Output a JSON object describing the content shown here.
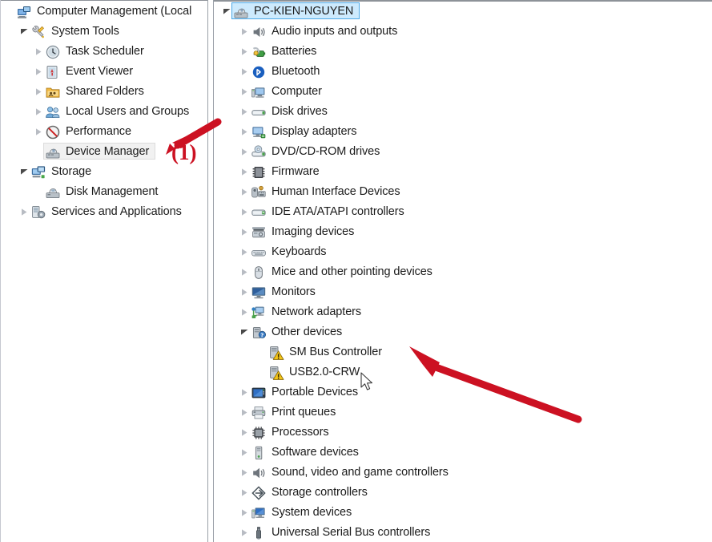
{
  "window": {
    "title": "Computer Management",
    "left_panel_name": "Console Tree",
    "right_panel_name": "Device Manager Tree"
  },
  "left_tree": [
    {
      "label": "Computer Management (Local",
      "depth": 0,
      "twisty": "none",
      "icon": "computer-management-icon",
      "selected": "none"
    },
    {
      "label": "System Tools",
      "depth": 1,
      "twisty": "expanded",
      "icon": "system-tools-icon",
      "selected": "none"
    },
    {
      "label": "Task Scheduler",
      "depth": 2,
      "twisty": "collapsed",
      "icon": "clock-icon",
      "selected": "none"
    },
    {
      "label": "Event Viewer",
      "depth": 2,
      "twisty": "collapsed",
      "icon": "event-viewer-icon",
      "selected": "none"
    },
    {
      "label": "Shared Folders",
      "depth": 2,
      "twisty": "collapsed",
      "icon": "shared-folders-icon",
      "selected": "none"
    },
    {
      "label": "Local Users and Groups",
      "depth": 2,
      "twisty": "collapsed",
      "icon": "users-group-icon",
      "selected": "none"
    },
    {
      "label": "Performance",
      "depth": 2,
      "twisty": "collapsed",
      "icon": "performance-icon",
      "selected": "none"
    },
    {
      "label": "Device Manager",
      "depth": 2,
      "twisty": "none",
      "icon": "device-manager-icon",
      "selected": "gray"
    },
    {
      "label": "Storage",
      "depth": 1,
      "twisty": "expanded",
      "icon": "storage-icon",
      "selected": "none"
    },
    {
      "label": "Disk Management",
      "depth": 2,
      "twisty": "none",
      "icon": "disk-management-icon",
      "selected": "none"
    },
    {
      "label": "Services and Applications",
      "depth": 1,
      "twisty": "collapsed",
      "icon": "services-icon",
      "selected": "none"
    }
  ],
  "right_tree": [
    {
      "label": "PC-KIEN-NGUYEN",
      "depth": 0,
      "twisty": "expanded",
      "icon": "computer-root-icon",
      "selected": "blue"
    },
    {
      "label": "Audio inputs and outputs",
      "depth": 1,
      "twisty": "collapsed",
      "icon": "audio-icon",
      "selected": "none"
    },
    {
      "label": "Batteries",
      "depth": 1,
      "twisty": "collapsed",
      "icon": "battery-icon",
      "selected": "none"
    },
    {
      "label": "Bluetooth",
      "depth": 1,
      "twisty": "collapsed",
      "icon": "bluetooth-icon",
      "selected": "none"
    },
    {
      "label": "Computer",
      "depth": 1,
      "twisty": "collapsed",
      "icon": "computer-icon",
      "selected": "none"
    },
    {
      "label": "Disk drives",
      "depth": 1,
      "twisty": "collapsed",
      "icon": "disk-drive-icon",
      "selected": "none"
    },
    {
      "label": "Display adapters",
      "depth": 1,
      "twisty": "collapsed",
      "icon": "display-adapter-icon",
      "selected": "none"
    },
    {
      "label": "DVD/CD-ROM drives",
      "depth": 1,
      "twisty": "collapsed",
      "icon": "dvd-drive-icon",
      "selected": "none"
    },
    {
      "label": "Firmware",
      "depth": 1,
      "twisty": "collapsed",
      "icon": "firmware-icon",
      "selected": "none"
    },
    {
      "label": "Human Interface Devices",
      "depth": 1,
      "twisty": "collapsed",
      "icon": "hid-icon",
      "selected": "none"
    },
    {
      "label": "IDE ATA/ATAPI controllers",
      "depth": 1,
      "twisty": "collapsed",
      "icon": "ide-controller-icon",
      "selected": "none"
    },
    {
      "label": "Imaging devices",
      "depth": 1,
      "twisty": "collapsed",
      "icon": "imaging-icon",
      "selected": "none"
    },
    {
      "label": "Keyboards",
      "depth": 1,
      "twisty": "collapsed",
      "icon": "keyboard-icon",
      "selected": "none"
    },
    {
      "label": "Mice and other pointing devices",
      "depth": 1,
      "twisty": "collapsed",
      "icon": "mouse-icon",
      "selected": "none"
    },
    {
      "label": "Monitors",
      "depth": 1,
      "twisty": "collapsed",
      "icon": "monitor-icon",
      "selected": "none"
    },
    {
      "label": "Network adapters",
      "depth": 1,
      "twisty": "collapsed",
      "icon": "network-adapter-icon",
      "selected": "none"
    },
    {
      "label": "Other devices",
      "depth": 1,
      "twisty": "expanded",
      "icon": "other-devices-icon",
      "selected": "none"
    },
    {
      "label": "SM Bus Controller",
      "depth": 2,
      "twisty": "none",
      "icon": "warning-device-icon",
      "selected": "none"
    },
    {
      "label": "USB2.0-CRW",
      "depth": 2,
      "twisty": "none",
      "icon": "warning-device-icon",
      "selected": "none"
    },
    {
      "label": "Portable Devices",
      "depth": 1,
      "twisty": "collapsed",
      "icon": "portable-device-icon",
      "selected": "none"
    },
    {
      "label": "Print queues",
      "depth": 1,
      "twisty": "collapsed",
      "icon": "printer-icon",
      "selected": "none"
    },
    {
      "label": "Processors",
      "depth": 1,
      "twisty": "collapsed",
      "icon": "processor-icon",
      "selected": "none"
    },
    {
      "label": "Software devices",
      "depth": 1,
      "twisty": "collapsed",
      "icon": "software-device-icon",
      "selected": "none"
    },
    {
      "label": "Sound, video and game controllers",
      "depth": 1,
      "twisty": "collapsed",
      "icon": "sound-icon",
      "selected": "none"
    },
    {
      "label": "Storage controllers",
      "depth": 1,
      "twisty": "collapsed",
      "icon": "storage-controller-icon",
      "selected": "none"
    },
    {
      "label": "System devices",
      "depth": 1,
      "twisty": "collapsed",
      "icon": "system-device-icon",
      "selected": "none"
    },
    {
      "label": "Universal Serial Bus controllers",
      "depth": 1,
      "twisty": "collapsed",
      "icon": "usb-icon",
      "selected": "none"
    }
  ],
  "annotations": {
    "step_one_label": "(1)",
    "arrow_color": "#cc1122",
    "arrow_one_name": "arrow-pointing-to-device-manager",
    "arrow_two_name": "arrow-pointing-to-sm-bus-controller"
  },
  "colors": {
    "selection_blue_fill": "#cdeafd",
    "selection_blue_border": "#4ba7e6",
    "selection_gray_fill": "#f1f1f1",
    "text": "#1b1b1b",
    "annotation_red": "#cc1122"
  }
}
